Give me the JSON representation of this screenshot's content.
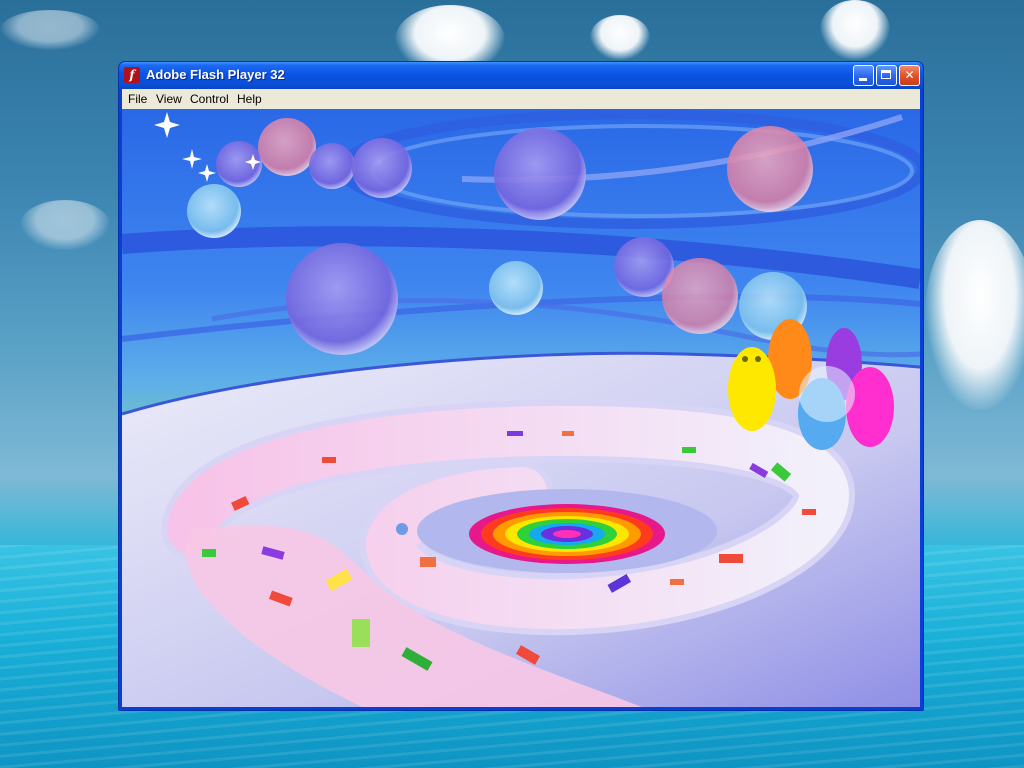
{
  "window": {
    "title": "Adobe Flash Player 32",
    "icon": "flash-player-icon",
    "buttons": {
      "minimize": "minimize-icon",
      "maximize": "maximize-icon",
      "close": "close-icon"
    }
  },
  "menubar": {
    "items": [
      "File",
      "View",
      "Control",
      "Help"
    ]
  },
  "stage": {
    "scene": "flash-animation",
    "colors": {
      "sky_top": "#2f6fe8",
      "sky_horizon": "#8fd7a0",
      "floor": "#e6e6f7",
      "path": "#f6c9ea",
      "bubble_purple": "#8a7de8",
      "bubble_pink": "#e98fae",
      "bubble_blue": "#8ccff2"
    }
  }
}
